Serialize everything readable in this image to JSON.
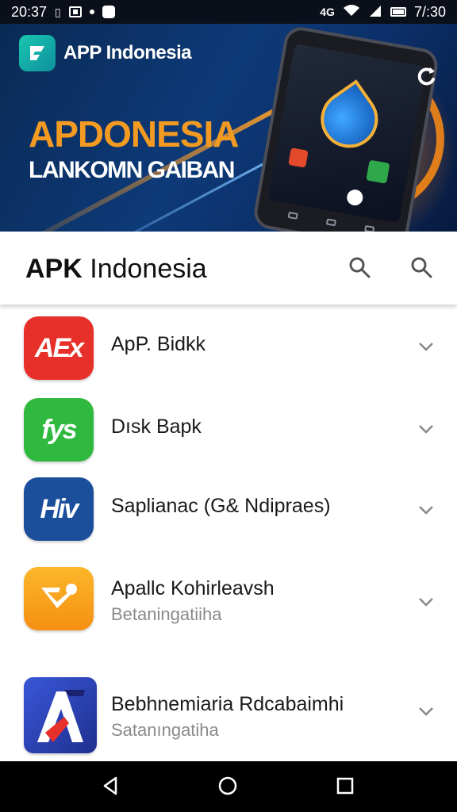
{
  "status_bar": {
    "time_left": "20:37",
    "time_right": "7/:30",
    "network_label": "4G",
    "icons": [
      "sim-icon",
      "notification-box-icon",
      "dot-icon",
      "app-pill-icon",
      "network-icon",
      "wifi-icon",
      "signal-icon",
      "battery-icon"
    ]
  },
  "hero": {
    "logo_text": "APP Indonesia",
    "title": "APDONESIA",
    "subtitle": "LANKOMN GAIBAN",
    "colors": {
      "title": "#f39a22",
      "background": "#0d3a78",
      "accent_ring": "#ff8c14"
    },
    "action_icon": "refresh-icon"
  },
  "app_bar": {
    "title_bold": "APK",
    "title_rest": " Indonesia",
    "icons": [
      "search-icon",
      "search-icon"
    ]
  },
  "apps": [
    {
      "name": "ApP. Bidkk",
      "subtitle": "",
      "icon_text": "AEx",
      "icon_color": "#e8302a"
    },
    {
      "name": "Dısk Bapk",
      "subtitle": "",
      "icon_text": "fys",
      "icon_color": "#2fb93f"
    },
    {
      "name": "Saplianac (G& Ndipraes)",
      "subtitle": "",
      "icon_text": "Hiv",
      "icon_color": "#1b4e9b"
    },
    {
      "name": "Apallc Kohirleavsh",
      "subtitle": "Betaningatiiha",
      "icon_text": "",
      "icon_color": "#f7a21b"
    },
    {
      "name": "Bebhnemiaria Rdcabaimhi",
      "subtitle": "Satanıngatiha",
      "icon_text": "A",
      "icon_color": "#2b3ea8"
    }
  ],
  "nav_bar": {
    "buttons": [
      "back-icon",
      "home-icon",
      "recent-apps-icon"
    ]
  }
}
